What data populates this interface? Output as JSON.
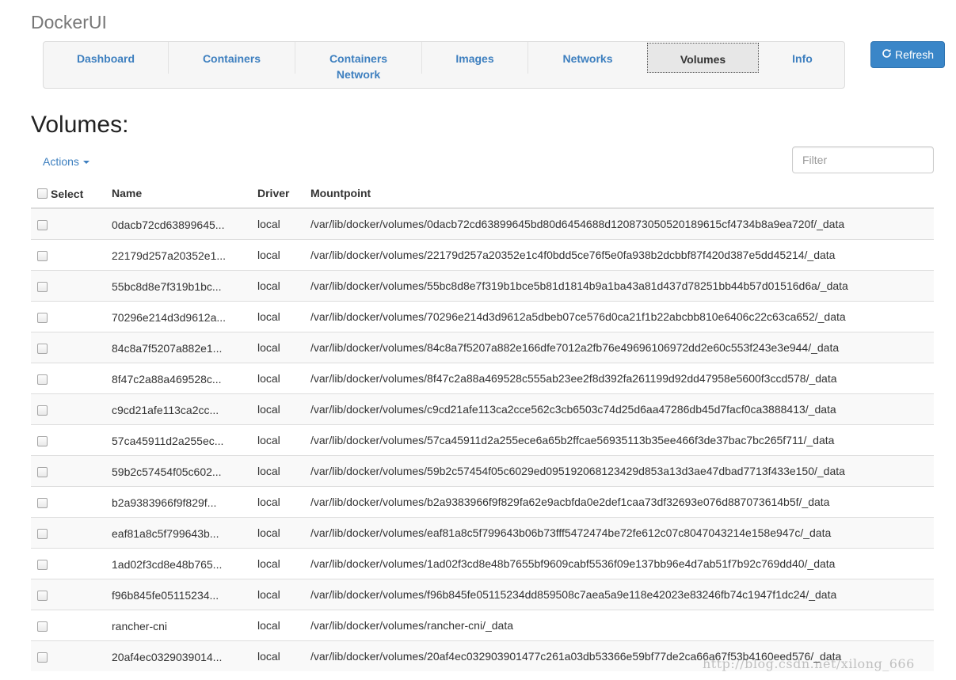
{
  "app": {
    "brand": "DockerUI"
  },
  "nav": {
    "items": [
      {
        "label": "Dashboard",
        "active": false
      },
      {
        "label": "Containers",
        "active": false
      },
      {
        "label": "Containers Network",
        "active": false
      },
      {
        "label": "Images",
        "active": false
      },
      {
        "label": "Networks",
        "active": false
      },
      {
        "label": "Volumes",
        "active": true
      },
      {
        "label": "Info",
        "active": false
      }
    ]
  },
  "toolbar": {
    "refresh_label": "Refresh",
    "refresh_icon": "refresh-icon"
  },
  "page": {
    "title": "Volumes:"
  },
  "actions": {
    "label": "Actions"
  },
  "filter": {
    "placeholder": "Filter",
    "value": ""
  },
  "table": {
    "headers": {
      "select": "Select",
      "name": "Name",
      "driver": "Driver",
      "mountpoint": "Mountpoint"
    },
    "rows": [
      {
        "name": "0dacb72cd63899645...",
        "driver": "local",
        "mountpoint": "/var/lib/docker/volumes/0dacb72cd63899645bd80d6454688d12087305052018961​5cf4734b8a9ea720f/_data"
      },
      {
        "name": "22179d257a20352e1...",
        "driver": "local",
        "mountpoint": "/var/lib/docker/volumes/22179d257a20352e1c4f0bdd5ce76f5e0fa938b2dcbbf87f420d387e5dd45214/_data"
      },
      {
        "name": "55bc8d8e7f319b1bc...",
        "driver": "local",
        "mountpoint": "/var/lib/docker/volumes/55bc8d8e7f319b1bce5b81d1814b9a1ba43a81d437d78251bb44b57d01516d6a/_data"
      },
      {
        "name": "70296e214d3d9612a...",
        "driver": "local",
        "mountpoint": "/var/lib/docker/volumes/70296e214d3d9612a5dbeb07ce576d0ca21f1b22abcbb810e6406c22c63ca652/_data"
      },
      {
        "name": "84c8a7f5207a882e1...",
        "driver": "local",
        "mountpoint": "/var/lib/docker/volumes/84c8a7f5207a882e166dfe7012a2fb76e49696106972dd2e60c553f243e3e944/_data"
      },
      {
        "name": "8f47c2a88a469528c...",
        "driver": "local",
        "mountpoint": "/var/lib/docker/volumes/8f47c2a88a469528c555ab23ee2f8d392fa261199d92dd47958e5600f3ccd578/_data"
      },
      {
        "name": "c9cd21afe113ca2cc...",
        "driver": "local",
        "mountpoint": "/var/lib/docker/volumes/c9cd21afe113ca2cce562c3cb6503c74d25d6aa47286db45d7facf0ca3888413/_data"
      },
      {
        "name": "57ca45911d2a255ec...",
        "driver": "local",
        "mountpoint": "/var/lib/docker/volumes/57ca45911d2a255ece6a65b2ffcae56935113b35ee466f3de37bac7bc265f711/_data"
      },
      {
        "name": "59b2c57454f05c602...",
        "driver": "local",
        "mountpoint": "/var/lib/docker/volumes/59b2c57454f05c6029ed095192068123429d853a13d3ae47dbad7713f433e150/_data"
      },
      {
        "name": "b2a9383966f9f829f...",
        "driver": "local",
        "mountpoint": "/var/lib/docker/volumes/b2a9383966f9f829fa62e9acbfda0e2def1caa73df32693e076d887073614b5f/_data"
      },
      {
        "name": "eaf81a8c5f799643b...",
        "driver": "local",
        "mountpoint": "/var/lib/docker/volumes/eaf81a8c5f799643b06b73fff5472474be72fe612c07c8047043214e158e947c/_data"
      },
      {
        "name": "1ad02f3cd8e48b765...",
        "driver": "local",
        "mountpoint": "/var/lib/docker/volumes/1ad02f3cd8e48b7655bf9609cabf5536f09e137bb96e4d7ab51f7b92c769dd40/_data"
      },
      {
        "name": "f96b845fe05115234...",
        "driver": "local",
        "mountpoint": "/var/lib/docker/volumes/f96b845fe05115234dd859508c7aea5a9e118e42023e83246fb74c1947f1dc24/_data"
      },
      {
        "name": "rancher-cni",
        "driver": "local",
        "mountpoint": "/var/lib/docker/volumes/rancher-cni/_data"
      },
      {
        "name": "20af4ec0329039014...",
        "driver": "local",
        "mountpoint": "/var/lib/docker/volumes/20af4ec032903901477c261a03db53366e59bf77de2ca66a67f53b4160eed576/_data"
      }
    ]
  },
  "watermark": {
    "text": "http://blog.csdn.net/xilong_666"
  }
}
